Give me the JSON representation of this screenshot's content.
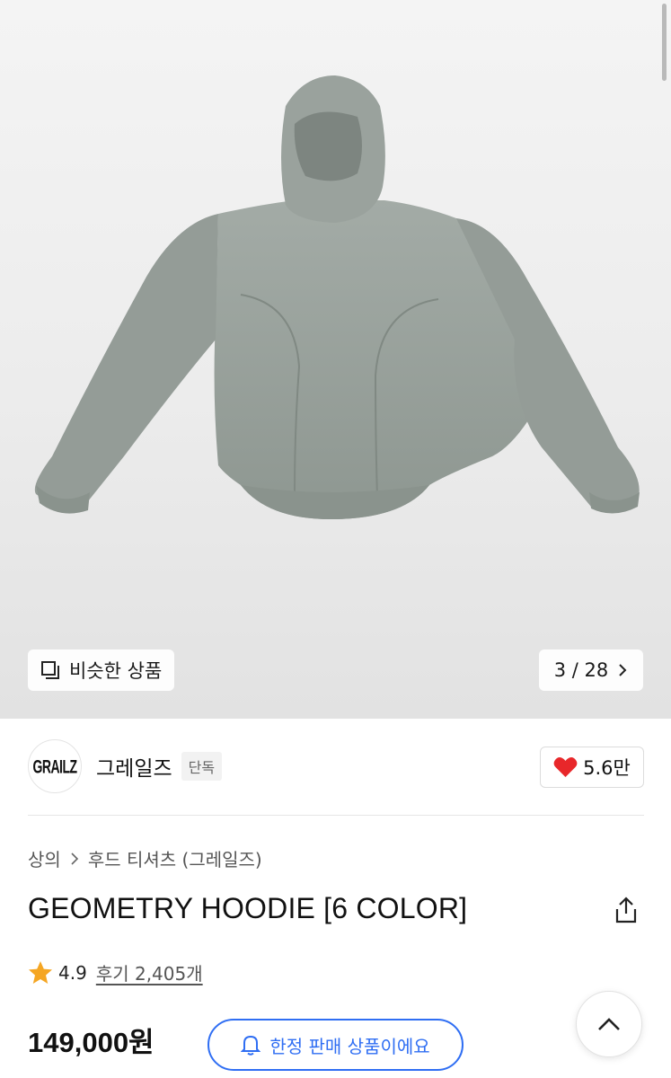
{
  "gallery": {
    "similar_button_label": "비슷한 상품",
    "counter_label": "3 / 28",
    "image_icon": "hoodie-product-image"
  },
  "brand": {
    "logo_text": "GRAILZ",
    "name": "그레일즈",
    "badge": "단독",
    "likes": "5.6만"
  },
  "breadcrumb": {
    "items": [
      "상의",
      "후드 티셔츠 (그레일즈)"
    ]
  },
  "product": {
    "title": "GEOMETRY HOODIE [6 COLOR]",
    "rating": "4.9",
    "review_label": "후기 2,405개",
    "price": "149,000원"
  },
  "actions": {
    "limited_label": "한정 판매 상품이에요"
  },
  "colors": {
    "accent": "#2f6ef3",
    "heart": "#e8272a",
    "star": "#f5a623",
    "hoodie": "#97a09a"
  }
}
